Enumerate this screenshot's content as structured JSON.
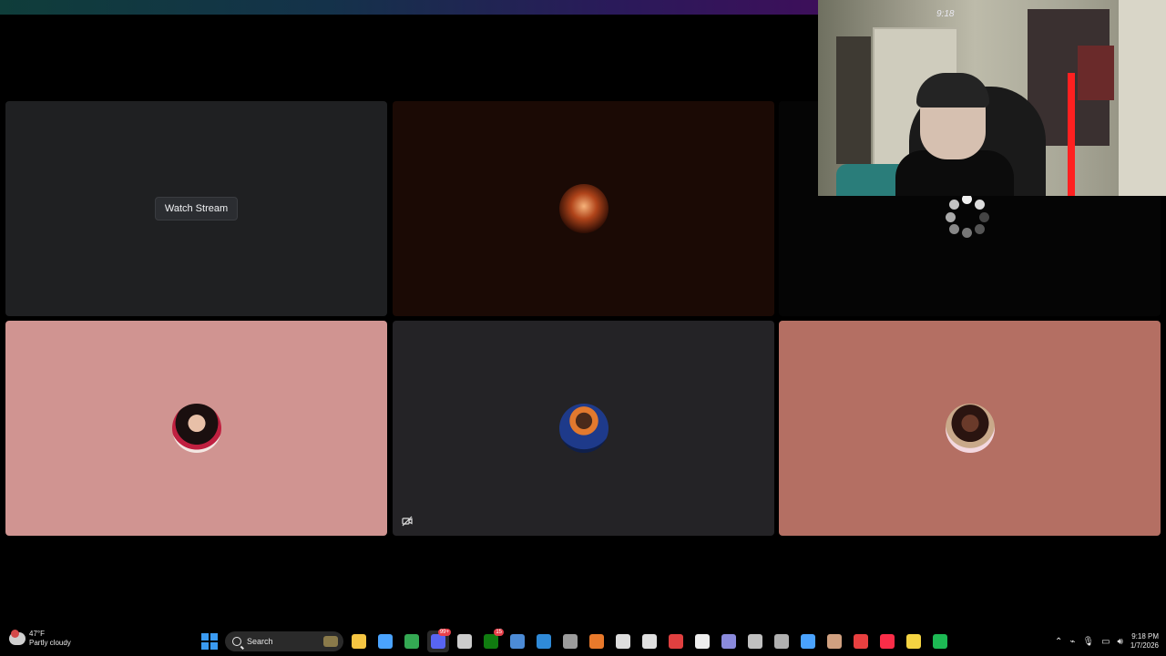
{
  "call": {
    "tiles": [
      {
        "id": "stream",
        "button_label": "Watch Stream"
      },
      {
        "id": "user-fire-avatar"
      },
      {
        "id": "user-loading"
      },
      {
        "id": "user-woman-avatar"
      },
      {
        "id": "user-juice-avatar",
        "muted_video": true
      },
      {
        "id": "user-girl-avatar"
      }
    ],
    "tile_colors": [
      "#1f2022",
      "#1b0a05",
      "#050505",
      "#d09491",
      "#242326",
      "#b46f63"
    ]
  },
  "webcam": {
    "clock_overlay": "9:18"
  },
  "taskbar": {
    "weather": {
      "temperature": "47°F",
      "condition": "Partly cloudy"
    },
    "search_label": "Search",
    "apps": [
      {
        "icon": "file-explorer-icon",
        "color": "#f5c542"
      },
      {
        "icon": "microsoft-store-icon",
        "color": "#4aa3ff"
      },
      {
        "icon": "chrome-icon",
        "color": "#34a853"
      },
      {
        "icon": "discord-icon",
        "color": "#5865f2",
        "badge": "99+"
      },
      {
        "icon": "epic-games-icon",
        "color": "#cccccc"
      },
      {
        "icon": "xbox-icon",
        "color": "#107c10",
        "badge": "15"
      },
      {
        "icon": "steam-icon",
        "color": "#4c8bd6"
      },
      {
        "icon": "blue-circle-app-icon",
        "color": "#2f8ad8"
      },
      {
        "icon": "minecraft-icon",
        "color": "#9c9c9c"
      },
      {
        "icon": "orange-app-icon",
        "color": "#e8792b"
      },
      {
        "icon": "pen-app-icon",
        "color": "#dddddd"
      },
      {
        "icon": "obs-icon",
        "color": "#e0e0e0"
      },
      {
        "icon": "power-app-icon",
        "color": "#e04040"
      },
      {
        "icon": "roblox-icon",
        "color": "#eeeeee"
      },
      {
        "icon": "chat-app-icon",
        "color": "#8a8adc"
      },
      {
        "icon": "4k-app-icon",
        "color": "#c0c0c0"
      },
      {
        "icon": "stripe-app-icon",
        "color": "#b0b0b0"
      },
      {
        "icon": "ccleaner-icon",
        "color": "#4aa3ff"
      },
      {
        "icon": "sticker-app-icon",
        "color": "#d0a080"
      },
      {
        "icon": "red-app-icon",
        "color": "#e84040"
      },
      {
        "icon": "music-app-icon",
        "color": "#fa2d48"
      },
      {
        "icon": "emoji-app-icon",
        "color": "#f5d442"
      },
      {
        "icon": "spotify-icon",
        "color": "#1db954"
      }
    ],
    "tray": {
      "time": "9:18 PM",
      "date": "1/7/2026"
    }
  }
}
